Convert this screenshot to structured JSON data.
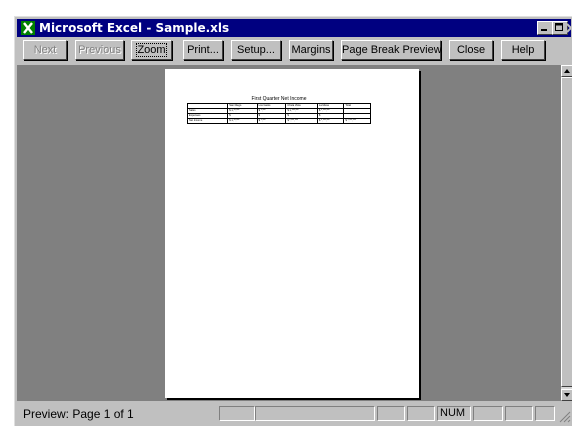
{
  "window": {
    "title": "Microsoft Excel - Sample.xls"
  },
  "toolbar": {
    "next": "Next",
    "previous": "Previous",
    "zoom": "Zoom",
    "print": "Print...",
    "setup": "Setup...",
    "margins": "Margins",
    "page_break_preview": "Page Break Preview",
    "close": "Close",
    "help": "Help"
  },
  "sheet": {
    "title": "First Quarter Net Income",
    "headers": [
      "",
      "San Diego",
      "Los Gatos",
      "Chula Vista",
      "La Mesa",
      "Total"
    ],
    "rows": [
      {
        "label": "Sales",
        "values": [
          "$ 1,**,***",
          "$ *,***",
          "$ 1,***,***",
          "$ *,***,***",
          ""
        ]
      },
      {
        "label": "Expenses",
        "values": [
          "$",
          "$",
          "$",
          "$",
          ""
        ]
      },
      {
        "label": "Net Income",
        "values": [
          "$ 1,**,***",
          "$ *,***",
          "$ *,***,***",
          "$ *,***,***",
          "$ *,***,***"
        ]
      }
    ]
  },
  "status": {
    "text": "Preview: Page 1 of 1",
    "num_indicator": "NUM"
  },
  "colors": {
    "titlebar": "#000080",
    "face": "#c0c0c0",
    "preview_bg": "#808080"
  }
}
